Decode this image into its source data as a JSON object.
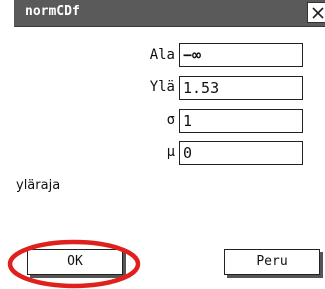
{
  "dialog": {
    "title": "normCDf",
    "close_label": "×"
  },
  "fields": {
    "lower": {
      "label": "Ala",
      "value": "−∞"
    },
    "upper": {
      "label": "Ylä",
      "value": "1.53"
    },
    "sigma": {
      "label": "σ",
      "value": "1"
    },
    "mu": {
      "label": "μ",
      "value": "0"
    }
  },
  "hint_text": "yläraja",
  "buttons": {
    "ok_label": "OK",
    "cancel_label": "Peru"
  },
  "colors": {
    "titlebar": "#5a5a5a",
    "highlight_ring": "#e0201c"
  }
}
